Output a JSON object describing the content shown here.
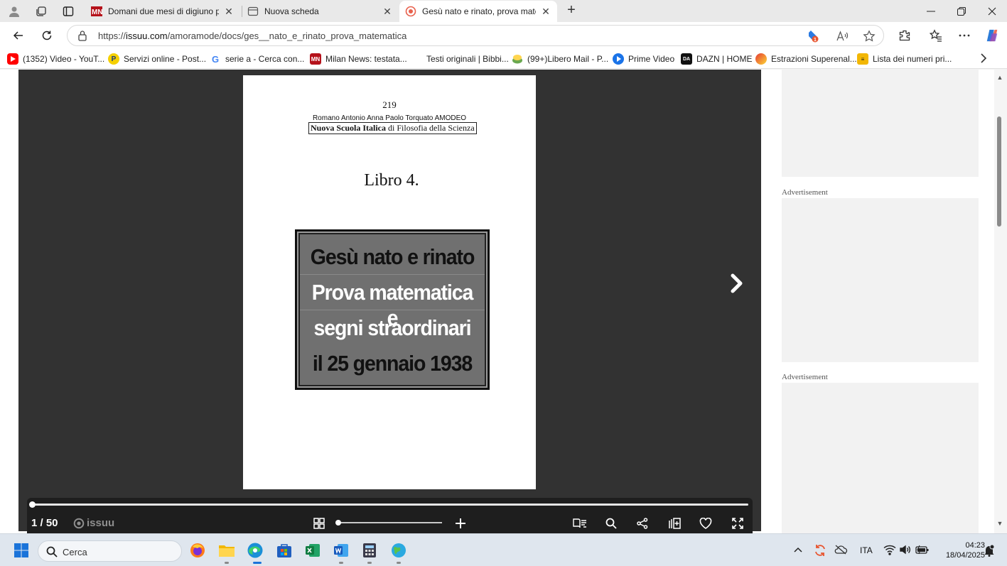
{
  "browser": {
    "tabs": [
      {
        "title": "Domani due mesi di digiuno per G",
        "favicon": "milan-news-icon",
        "active": false
      },
      {
        "title": "Nuova scheda",
        "favicon": "new-tab-page-icon",
        "active": false
      },
      {
        "title": "Gesù nato e rinato, prova matema",
        "favicon": "issuu-icon",
        "active": true
      }
    ],
    "url_prefix": "https://",
    "url_domain": "issuu.com",
    "url_path": "/amoramode/docs/ges__nato_e_rinato_prova_matematica",
    "favorites": [
      {
        "label": "(1352) Video - YouT...",
        "icon": "youtube-icon",
        "color": "#ff0000"
      },
      {
        "label": "Servizi online - Post...",
        "icon": "poste-icon",
        "color": "#f5d000"
      },
      {
        "label": "serie a - Cerca con...",
        "icon": "google-icon",
        "color": "#4285f4"
      },
      {
        "label": "Milan News: testata...",
        "icon": "milan-news-icon",
        "color": "#b5121b"
      },
      {
        "label": "Testi originali | Bibbi...",
        "icon": "blank-page-icon",
        "color": "#ffffff"
      },
      {
        "label": "(99+)Libero Mail - P...",
        "icon": "libero-icon",
        "color": "#6aa84f"
      },
      {
        "label": "Prime Video",
        "icon": "prime-video-icon",
        "color": "#1a73e8"
      },
      {
        "label": "DAZN | HOME",
        "icon": "dazn-icon",
        "color": "#111111"
      },
      {
        "label": "Estrazioni Superenal...",
        "icon": "superenalotto-icon",
        "color": "#e53935"
      },
      {
        "label": "Lista dei numeri pri...",
        "icon": "list-icon",
        "color": "#f2b705"
      }
    ]
  },
  "document": {
    "page_number": "219",
    "author": "Romano Antonio Anna Paolo Torquato AMODEO",
    "school_bold": "Nuova Scuola Italica",
    "school_rest": " di Filosofia della Scienza",
    "book": "Libro 4.",
    "cover_lines": [
      "Gesù nato e rinato",
      "Prova matematica e",
      "segni straordinari",
      "il 25 gennaio 1938"
    ]
  },
  "reader": {
    "page_indicator": "1 / 50",
    "brand": "issuu",
    "progress_fraction": 0.0,
    "zoom_fraction": 0.0
  },
  "sidebar": {
    "ad_label_1": "Advertisement",
    "ad_label_2": "Advertisement"
  },
  "taskbar": {
    "search_placeholder": "Cerca",
    "language": "ITA",
    "time": "04:23",
    "date": "18/04/2025"
  }
}
